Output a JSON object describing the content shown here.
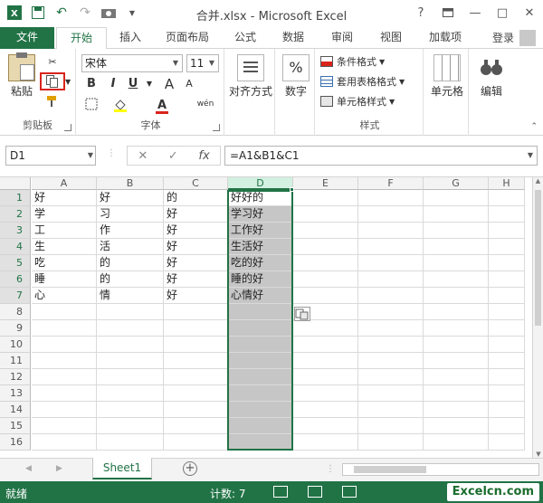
{
  "window": {
    "title": "合并.xlsx - Microsoft Excel",
    "help": "?",
    "login": "登录"
  },
  "tabs": [
    "文件",
    "开始",
    "插入",
    "页面布局",
    "公式",
    "数据",
    "审阅",
    "视图",
    "加载项"
  ],
  "ribbon": {
    "clipboard": {
      "label": "剪贴板",
      "paste": "粘贴"
    },
    "font": {
      "label": "字体",
      "name": "宋体",
      "size": "11",
      "bold": "B",
      "italic": "I",
      "underline": "U",
      "wen": "wén"
    },
    "align": {
      "label": "对齐方式"
    },
    "number": {
      "label": "数字",
      "symbol": "%"
    },
    "styles": {
      "label": "样式",
      "cond": "条件格式",
      "table": "套用表格格式",
      "cell": "单元格样式"
    },
    "cells": {
      "label": "单元格"
    },
    "edit": {
      "label": "编辑"
    }
  },
  "formula_bar": {
    "name_box": "D1",
    "formula": "=A1&B1&C1",
    "fx": "fx"
  },
  "grid": {
    "columns": [
      "A",
      "B",
      "C",
      "D",
      "E",
      "F",
      "G",
      "H"
    ],
    "rows": [
      "1",
      "2",
      "3",
      "4",
      "5",
      "6",
      "7",
      "8",
      "9",
      "10",
      "11",
      "12",
      "13",
      "14",
      "15",
      "16"
    ],
    "cells": [
      [
        "好",
        "好",
        "的",
        "好好的"
      ],
      [
        "学",
        "习",
        "好",
        "学习好"
      ],
      [
        "工",
        "作",
        "好",
        "工作好"
      ],
      [
        "生",
        "活",
        "好",
        "生活好"
      ],
      [
        "吃",
        "的",
        "好",
        "吃的好"
      ],
      [
        "睡",
        "的",
        "好",
        "睡的好"
      ],
      [
        "心",
        "情",
        "好",
        "心情好"
      ]
    ]
  },
  "sheet": {
    "name": "Sheet1",
    "add": "+"
  },
  "status": {
    "ready": "就绪",
    "count": "计数: 7",
    "watermark": "Excelcn.com"
  }
}
